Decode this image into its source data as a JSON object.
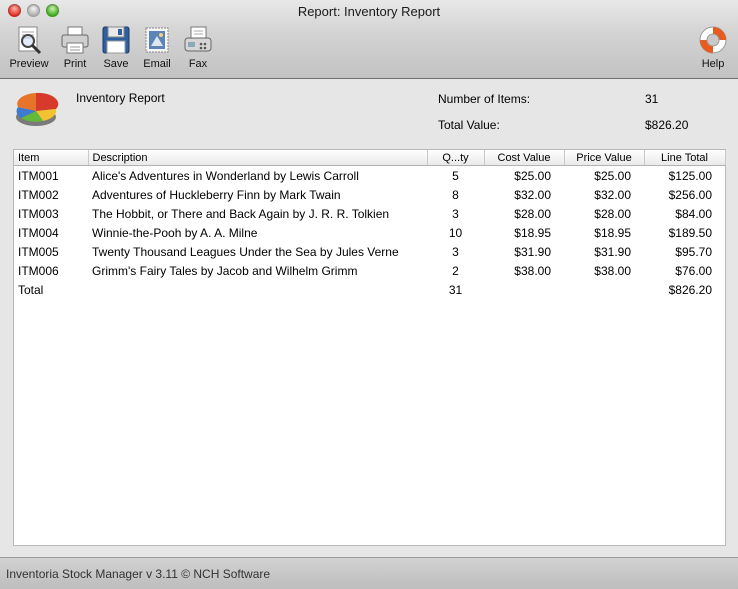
{
  "window": {
    "title": "Report: Inventory Report"
  },
  "toolbar": {
    "preview": {
      "label": "Preview",
      "icon": "magnifier-document-icon"
    },
    "print": {
      "label": "Print",
      "icon": "printer-icon"
    },
    "save": {
      "label": "Save",
      "icon": "floppy-disk-icon"
    },
    "email": {
      "label": "Email",
      "icon": "stamp-envelope-icon"
    },
    "fax": {
      "label": "Fax",
      "icon": "fax-machine-icon"
    },
    "help": {
      "label": "Help",
      "icon": "lifebuoy-icon"
    }
  },
  "report": {
    "title": "Inventory Report",
    "number_of_items_label": "Number of Items:",
    "number_of_items_value": "31",
    "total_value_label": "Total Value:",
    "total_value_value": "$826.20"
  },
  "table": {
    "columns": [
      "Item",
      "Description",
      "Q...ty",
      "Cost Value",
      "Price Value",
      "Line Total"
    ],
    "rows": [
      [
        "ITM001",
        "Alice's Adventures in Wonderland by Lewis Carroll",
        "5",
        "$25.00",
        "$25.00",
        "$125.00"
      ],
      [
        "ITM002",
        "Adventures of Huckleberry Finn by Mark Twain",
        "8",
        "$32.00",
        "$32.00",
        "$256.00"
      ],
      [
        "ITM003",
        "The Hobbit, or There and Back Again by J. R. R. Tolkien",
        "3",
        "$28.00",
        "$28.00",
        "$84.00"
      ],
      [
        "ITM004",
        "Winnie-the-Pooh by A. A. Milne",
        "10",
        "$18.95",
        "$18.95",
        "$189.50"
      ],
      [
        "ITM005",
        "Twenty Thousand Leagues Under the Sea by Jules Verne",
        "3",
        "$31.90",
        "$31.90",
        "$95.70"
      ],
      [
        "ITM006",
        "Grimm's Fairy Tales by Jacob and Wilhelm Grimm",
        "2",
        "$38.00",
        "$38.00",
        "$76.00"
      ]
    ],
    "total_row": [
      "Total",
      "",
      "31",
      "",
      "",
      "$826.20"
    ]
  },
  "status": {
    "text": "Inventoria Stock Manager v 3.11 © NCH Software"
  },
  "colors": {
    "close": "#d8261a",
    "minimize": "#a8a8a8",
    "zoom": "#39a21b"
  }
}
